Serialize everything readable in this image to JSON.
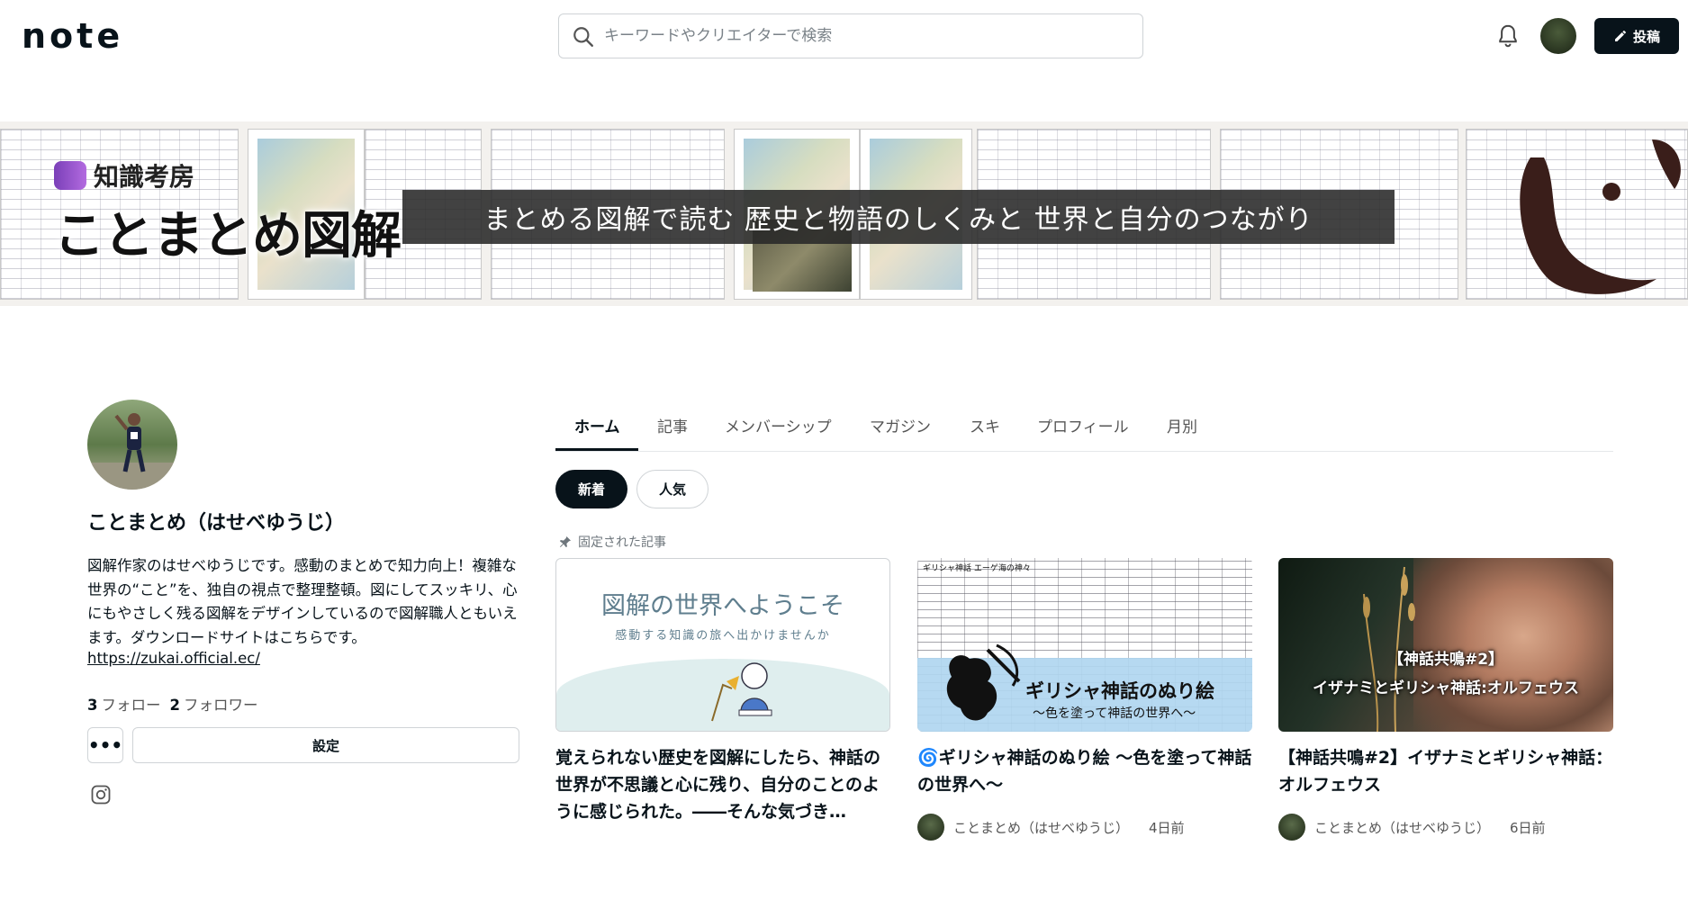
{
  "header": {
    "logo": "note",
    "search_placeholder": "キーワードやクリエイターで検索",
    "post_label": "投稿"
  },
  "banner": {
    "brand_small": "知識考房",
    "brand_big": "ことまとめ図解",
    "tagline": "まとめる図解で読む 歴史と物語のしくみと 世界と自分のつながり"
  },
  "profile": {
    "name": "ことまとめ（はせべゆうじ）",
    "bio": "図解作家のはせべゆうじです。感動のまとめで知力向上！複雑な世界の“こと”を、独自の視点で整理整頓。図にしてスッキリ、心にもやさしく残る図解をデザインしているので図解職人ともいえます。ダウンロードサイトはこちらです。",
    "link": "https://zukai.official.ec/",
    "following_count": "3",
    "following_label": "フォロー",
    "followers_count": "2",
    "followers_label": "フォロワー",
    "more_label": "•••",
    "settings_label": "設定"
  },
  "tabs": [
    "ホーム",
    "記事",
    "メンバーシップ",
    "マガジン",
    "スキ",
    "プロフィール",
    "月別"
  ],
  "filters": {
    "new": "新着",
    "popular": "人気"
  },
  "pinned_label": "固定された記事",
  "cards": [
    {
      "img_title": "図解の世界へようこそ",
      "img_sub": "感動する知識の旅へ出かけませんか",
      "title": "覚えられない歴史を図解にしたら、神話の世界が不思議と心に残り、自分のことのように感じられた。――そんな気づき…",
      "author": "",
      "time": ""
    },
    {
      "img_header": "ギリシャ神話 エーゲ海の神々",
      "img_title": "ギリシャ神話のぬり絵",
      "img_sub": "〜色を塗って神話の世界へ〜",
      "title": "🌀ギリシャ神話のぬり絵 〜色を塗って神話の世界へ〜",
      "author": "ことまとめ（はせべゆうじ）",
      "time": "4日前"
    },
    {
      "img_cap1": "【神話共鳴#2】",
      "img_cap2": "イザナミとギリシャ神話:オルフェウス",
      "title": "【神話共鳴#2】イザナミとギリシャ神話：オルフェウス",
      "author": "ことまとめ（はせべゆうじ）",
      "time": "6日前"
    }
  ]
}
